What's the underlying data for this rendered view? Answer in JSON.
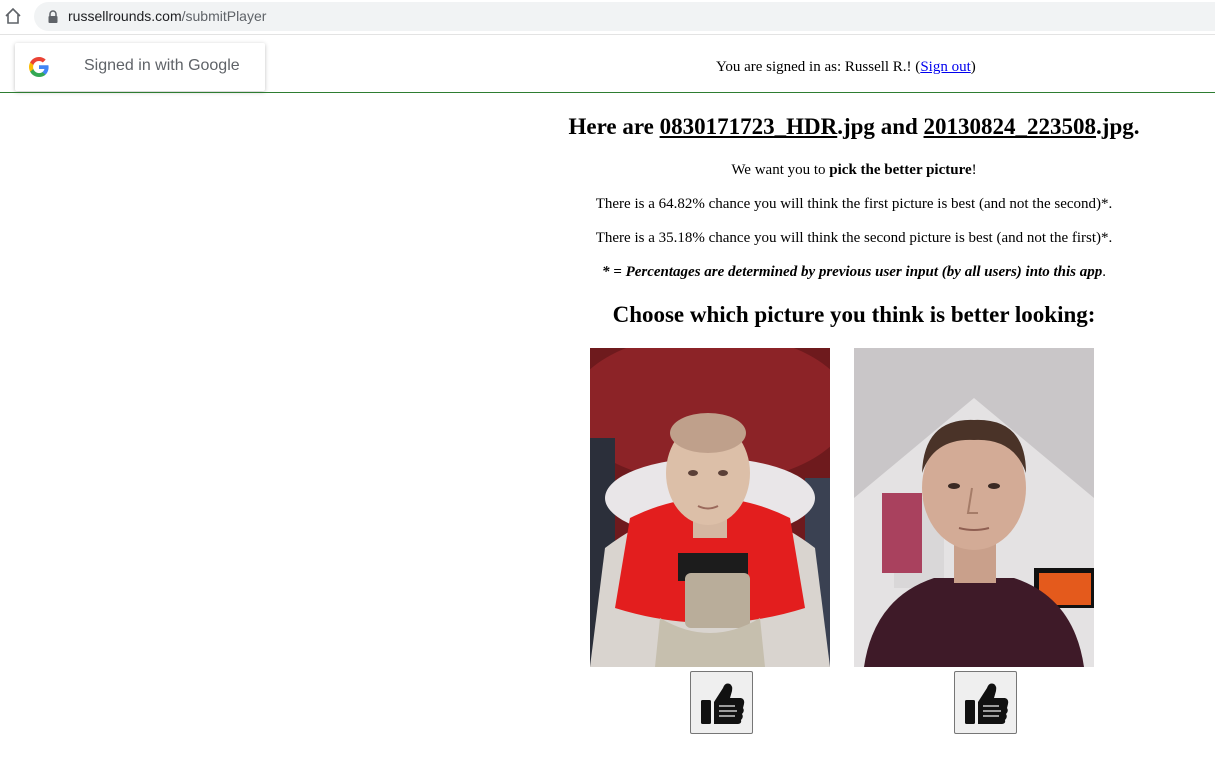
{
  "browser": {
    "url_host": "russellrounds.com",
    "url_path": "/submitPlayer"
  },
  "signin_popup": {
    "label": "Signed in with Google"
  },
  "header": {
    "signed_in_prefix": "You are signed in as: Russell R.! (",
    "sign_out_label": "Sign out",
    "signed_in_suffix": ")",
    "rule_color": "#2e7d32"
  },
  "main": {
    "heading_prefix": "Here are ",
    "file_1": "0830171723_HDR",
    "file_1_ext": ".jpg",
    "heading_and": " and ",
    "file_2": "20130824_223508",
    "file_2_ext": ".jpg.",
    "instruction_prefix": "We want you to ",
    "instruction_bold": "pick the better picture",
    "instruction_suffix": "!",
    "chance_first": "There is a 64.82% chance you will think the first picture is best (and not the second)*.",
    "chance_second": "There is a 35.18% chance you will think the second picture is best (and not the first)*.",
    "footnote_bold": "* = Percentages are determined by previous user input (by all users) into this app",
    "footnote_end": ".",
    "choose_heading": "Choose which picture you think is better looking:"
  },
  "pictures": [
    {
      "icon": "thumbs-up-icon"
    },
    {
      "icon": "thumbs-up-icon"
    }
  ]
}
